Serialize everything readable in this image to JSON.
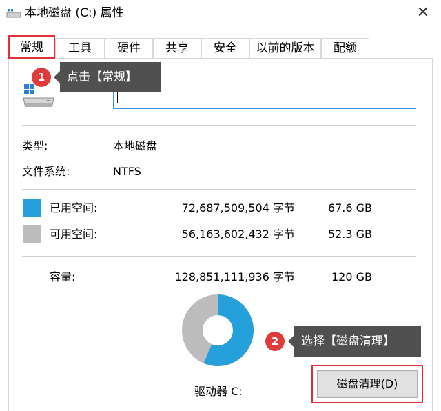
{
  "window": {
    "title": "本地磁盘 (C:) 属性",
    "close_glyph": "✕"
  },
  "tabs": [
    {
      "label": "常规"
    },
    {
      "label": "工具"
    },
    {
      "label": "硬件"
    },
    {
      "label": "共享"
    },
    {
      "label": "安全"
    },
    {
      "label": "以前的版本"
    },
    {
      "label": "配额"
    }
  ],
  "volume": {
    "name_value": "",
    "type_label": "类型:",
    "type_value": "本地磁盘",
    "fs_label": "文件系统:",
    "fs_value": "NTFS"
  },
  "usage": {
    "used_label": "已用空间:",
    "used_bytes": "72,687,509,504 字节",
    "used_gb": "67.6 GB",
    "used_color": "#26a0da",
    "free_label": "可用空间:",
    "free_bytes": "56,163,602,432 字节",
    "free_gb": "52.3 GB",
    "free_color": "#bcbcbc",
    "capacity_label": "容量:",
    "capacity_bytes": "128,851,111,936 字节",
    "capacity_gb": "120 GB",
    "used_fraction": 0.564
  },
  "drive_label": "驱动器 C:",
  "cleanup_button": "磁盘清理(D)",
  "annotations": {
    "step1_number": "1",
    "step1_text": "点击【常规】",
    "step2_number": "2",
    "step2_text": "选择【磁盘清理】",
    "highlight_color": "#e0303a"
  }
}
